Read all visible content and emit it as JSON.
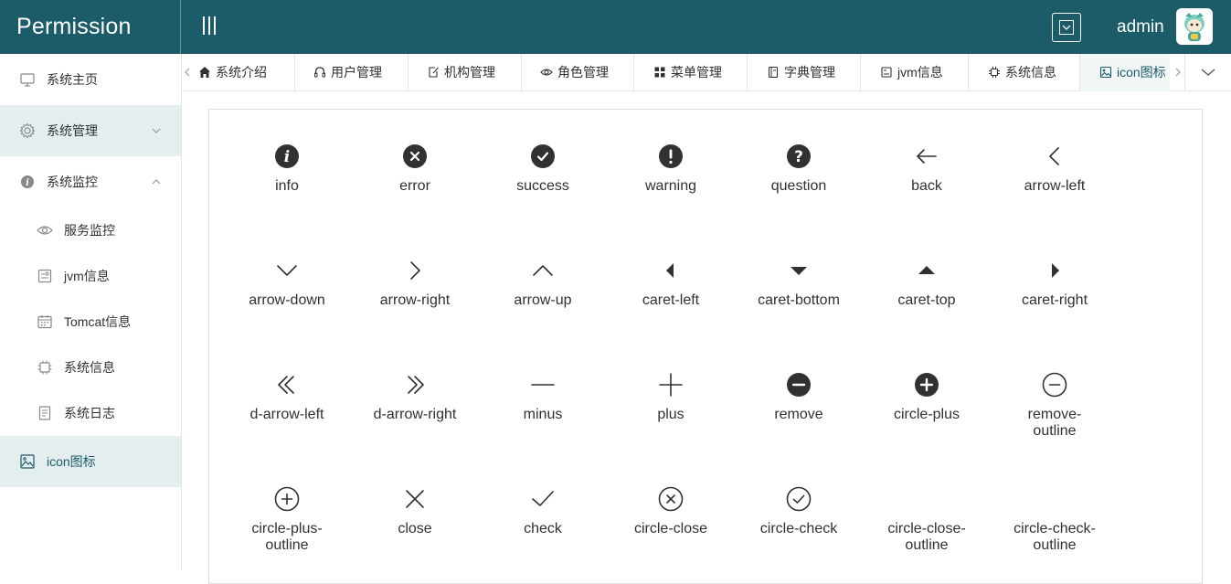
{
  "header": {
    "brand": "Permission",
    "username": "admin"
  },
  "sidebar": {
    "items": [
      {
        "label": "系统主页",
        "icon": "monitor-icon"
      },
      {
        "label": "系统管理",
        "icon": "gear-icon",
        "expanded": false
      },
      {
        "label": "系统监控",
        "icon": "info-icon",
        "expanded": true
      },
      {
        "label": "服务监控",
        "icon": "eye-icon"
      },
      {
        "label": "jvm信息",
        "icon": "tickets-icon"
      },
      {
        "label": "Tomcat信息",
        "icon": "calendar-icon"
      },
      {
        "label": "系统信息",
        "icon": "cpu-icon"
      },
      {
        "label": "系统日志",
        "icon": "document-icon"
      },
      {
        "label": "icon图标",
        "icon": "picture-icon"
      }
    ]
  },
  "tabs": [
    {
      "label": "系统介绍",
      "icon": "home-icon"
    },
    {
      "label": "用户管理",
      "icon": "headset-icon"
    },
    {
      "label": "机构管理",
      "icon": "edit-icon"
    },
    {
      "label": "角色管理",
      "icon": "eye-icon"
    },
    {
      "label": "菜单管理",
      "icon": "menu-icon"
    },
    {
      "label": "字典管理",
      "icon": "notebook-icon"
    },
    {
      "label": "jvm信息",
      "icon": "tickets-icon"
    },
    {
      "label": "系统信息",
      "icon": "cpu-icon"
    },
    {
      "label": "icon图标",
      "icon": "picture-icon"
    }
  ],
  "icons": [
    [
      "info",
      "error",
      "success",
      "warning",
      "question",
      "back",
      "arrow-left"
    ],
    [
      "arrow-down",
      "arrow-right",
      "arrow-up",
      "caret-left",
      "caret-bottom",
      "caret-top",
      "caret-right"
    ],
    [
      "d-arrow-left",
      "d-arrow-right",
      "minus",
      "plus",
      "remove",
      "circle-plus",
      "remove-\noutline"
    ],
    [
      "circle-plus-\noutline",
      "close",
      "check",
      "circle-close",
      "circle-check",
      "circle-close-\noutline",
      "circle-check-\noutline"
    ]
  ],
  "colors": {
    "brand": "#1c5c68",
    "active_bg": "#e4eeef",
    "icon": "#303133"
  }
}
